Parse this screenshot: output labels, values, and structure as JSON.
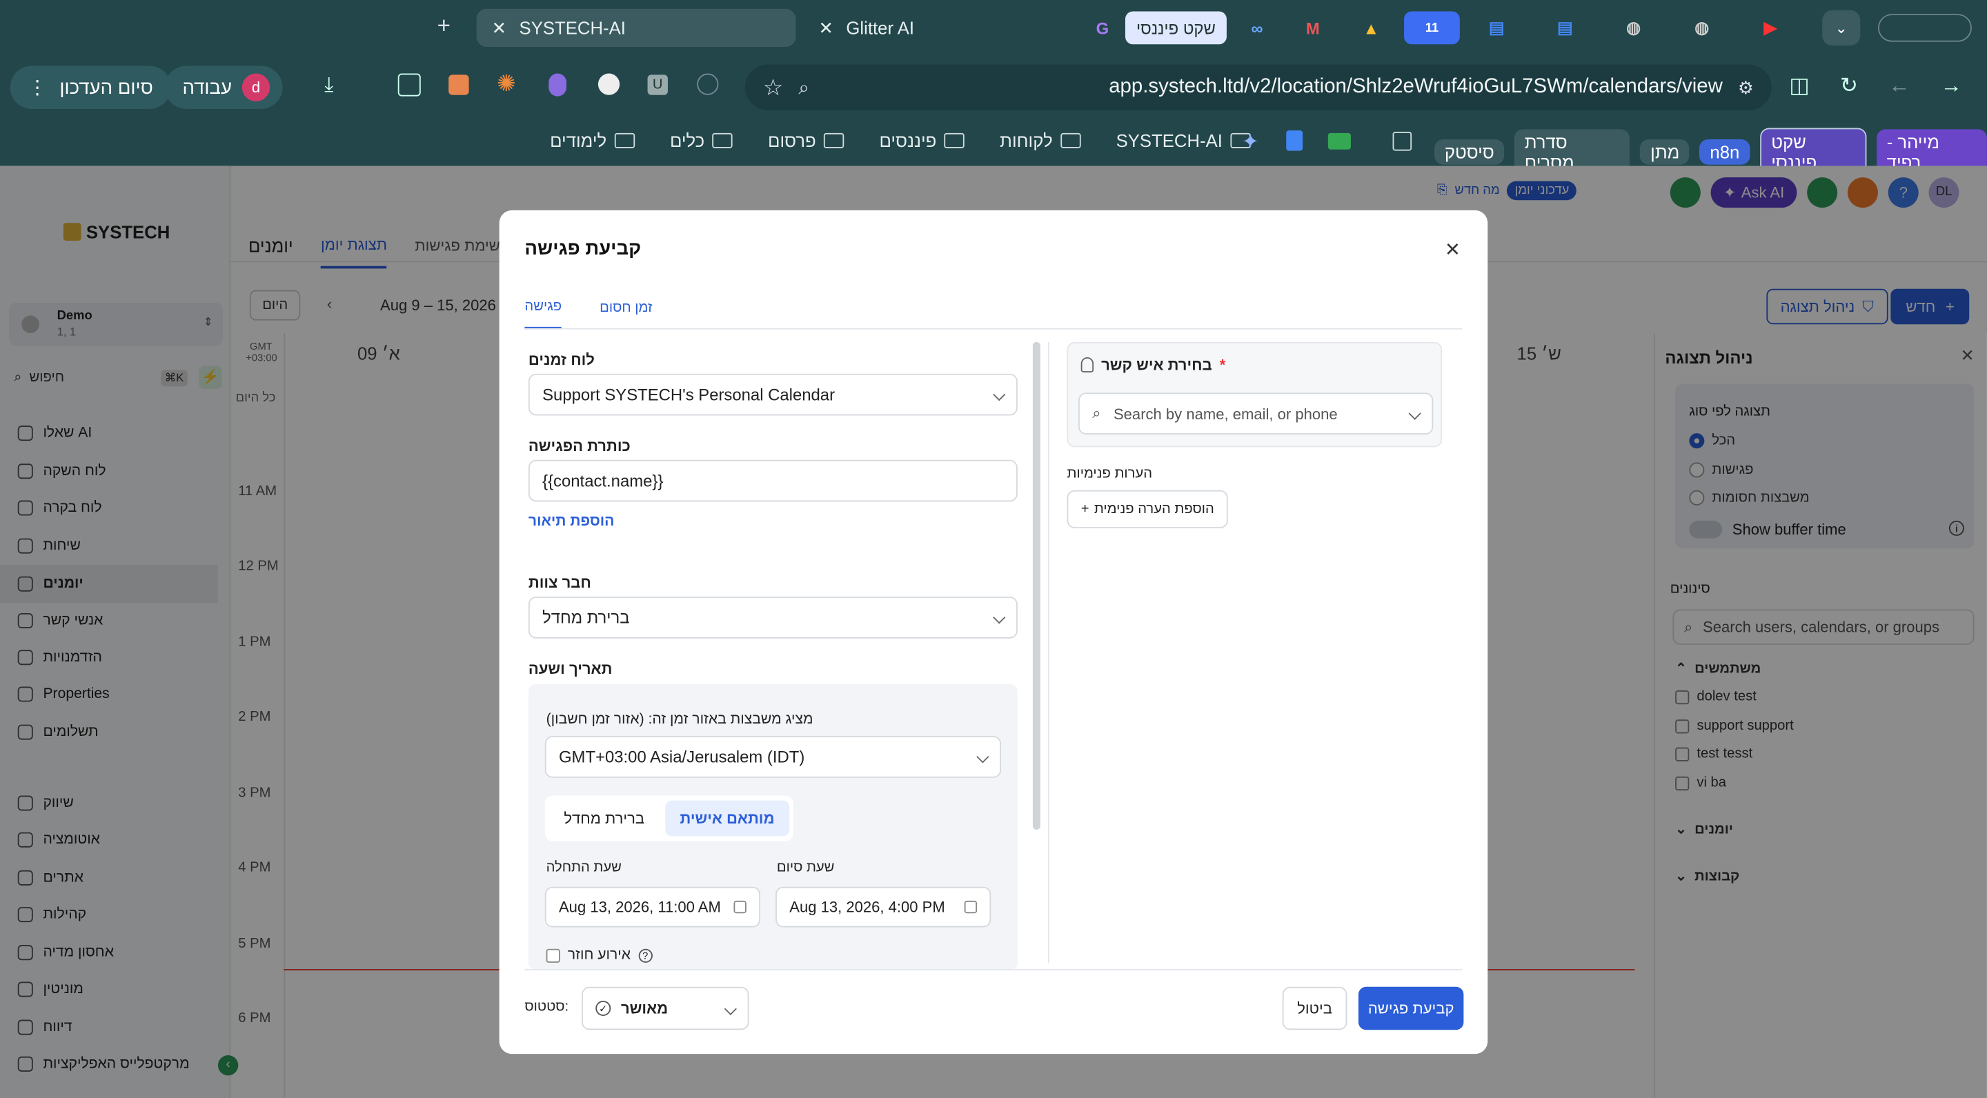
{
  "browser": {
    "tabs": [
      {
        "label": "SYSTECH-AI",
        "active": true
      },
      {
        "label": "Glitter AI",
        "active": false
      }
    ],
    "pinned_chip": "שקט פיננסי",
    "url": "app.systech.ltd/v2/location/Shlz2eWruf4ioGuL7SWm/calendars/view",
    "profile_label": "עבודה",
    "profile_initial": "d",
    "edit_end_label": "סיום העדכון",
    "bookmarks": [
      "לימודים",
      "כלים",
      "פרסום",
      "פיננסים",
      "לקוחות",
      "SYSTECH-AI"
    ],
    "bm_chips": [
      "סיסטק",
      "סדרת מסרים",
      "מתן",
      "n8n",
      "שקט פיננסי",
      "מייהר - רפיד"
    ]
  },
  "app": {
    "brand": "SYSTECH",
    "tabs": [
      "יומנים",
      "תצוגת יומן",
      "תצוגת רשימת פגישות"
    ],
    "whats_new": "מה חדש",
    "cal_updates": "עדכוני יומן",
    "ask_ai": "Ask AI",
    "avatar": "DL",
    "new_btn": "חדש",
    "manage_view_btn": "ניהול תצוגה",
    "location": {
      "name": "Demo",
      "sub": "1, 1"
    },
    "search": "חיפוש",
    "search_kbd": "⌘K",
    "today_btn": "היום",
    "date_range": "Aug 9 – 15, 2026",
    "gmt": "GMT +03:00",
    "all_day": "כל היום",
    "day_left": "09 א׳",
    "day_right": "15 ש׳",
    "hours": [
      "11 AM",
      "12 PM",
      "1 PM",
      "2 PM",
      "3 PM",
      "4 PM",
      "5 PM",
      "6 PM"
    ],
    "nav": [
      "שאלו AI",
      "לוח השקה",
      "לוח בקרה",
      "שיחות",
      "יומנים",
      "אנשי קשר",
      "הזדמנויות",
      "Properties",
      "תשלומים",
      "שיווק",
      "אוטומציה",
      "אתרים",
      "קהילות",
      "אחסון מדיה",
      "מוניטין",
      "דיווח",
      "מרקטפלייס האפליקציות"
    ]
  },
  "right_panel": {
    "title": "ניהול תצוגה",
    "view_by_type": "תצוגה לפי סוג",
    "radio": [
      "הכל",
      "פגישות",
      "משבצות חסומות"
    ],
    "buffer": "Show buffer time",
    "filters": "סינונים",
    "search_placeholder": "Search users, calendars, or groups",
    "users_header": "משתמשים",
    "users": [
      "dolev test",
      "support support",
      "test tesst",
      "vi ba"
    ],
    "calendars": "יומנים",
    "groups": "קבוצות"
  },
  "modal": {
    "title": "קביעת פגישה",
    "tabs": [
      "פגישה",
      "זמן חסום"
    ],
    "calendar_label": "לוח זמנים",
    "calendar_value": "Support SYSTECH's Personal Calendar",
    "meeting_title_label": "כותרת הפגישה",
    "meeting_title_value": "{{contact.name}}",
    "add_description": "הוספת תיאור",
    "team_member_label": "חבר צוות",
    "team_member_value": "ברירת מחדל",
    "datetime_label": "תאריך ושעה",
    "tz_note": "מציג משבצות באזור זמן זה: (אזור זמן חשבון)",
    "tz_value": "GMT+03:00 Asia/Jerusalem (IDT)",
    "mode_custom": "מותאם אישית",
    "mode_default": "ברירת מחדל",
    "start_label": "שעת התחלה",
    "start_value": "Aug 13, 2026, 11:00 AM",
    "end_label": "שעת סיום",
    "end_value": "Aug 13, 2026, 4:00 PM",
    "recurring": "אירוע חוזר",
    "contact_label": "בחירת איש קשר",
    "required_star": "*",
    "contact_placeholder": "Search by name, email, or phone",
    "internal_notes": "הערות פנימיות",
    "add_internal_note": "הוספת הערה פנימית",
    "status_label": "סטטוס:",
    "status_value": "מאושר",
    "cancel": "ביטול",
    "submit": "קביעת פגישה"
  }
}
